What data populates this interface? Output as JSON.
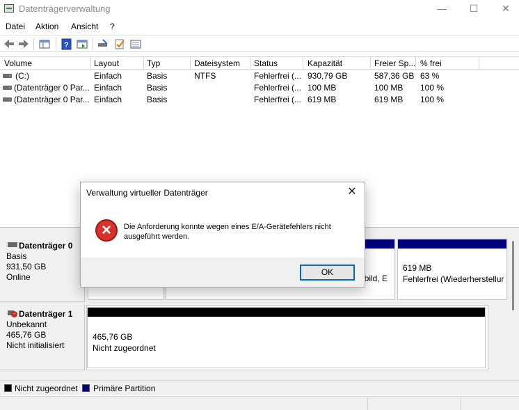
{
  "window": {
    "title": "Datenträgerverwaltung",
    "minimize_icon": "minimize-icon",
    "maximize_icon": "maximize-icon",
    "close_icon": "close-icon"
  },
  "menu": {
    "items": [
      "Datei",
      "Aktion",
      "Ansicht",
      "?"
    ]
  },
  "volume_list": {
    "columns": [
      "Volume",
      "Layout",
      "Typ",
      "Dateisystem",
      "Status",
      "Kapazität",
      "Freier Sp...",
      "% frei"
    ],
    "rows": [
      {
        "volume": "(C:)",
        "layout": "Einfach",
        "typ": "Basis",
        "dateisystem": "NTFS",
        "status": "Fehlerfrei (...",
        "kapazitaet": "930,79 GB",
        "frei": "587,36 GB",
        "prozent": "63 %"
      },
      {
        "volume": "(Datenträger 0 Par...",
        "layout": "Einfach",
        "typ": "Basis",
        "dateisystem": "",
        "status": "Fehlerfrei (...",
        "kapazitaet": "100 MB",
        "frei": "100 MB",
        "prozent": "100 %"
      },
      {
        "volume": "(Datenträger 0 Par...",
        "layout": "Einfach",
        "typ": "Basis",
        "dateisystem": "",
        "status": "Fehlerfrei (...",
        "kapazitaet": "619 MB",
        "frei": "619 MB",
        "prozent": "100 %"
      }
    ]
  },
  "disks": [
    {
      "name": "Datenträger 0",
      "type": "Basis",
      "size": "931,50 GB",
      "state": "Online",
      "partitions": [
        {
          "visible_text_1": "",
          "visible_text_2": ""
        },
        {
          "visible_text_1": "",
          "visible_text_2": "bbild, E"
        },
        {
          "visible_text_1": "619 MB",
          "visible_text_2": "Fehlerfrei (Wiederherstellur"
        }
      ]
    },
    {
      "name": "Datenträger 1",
      "type": "Unbekannt",
      "size": "465,76 GB",
      "state": "Nicht initialisiert",
      "partitions": [
        {
          "visible_text_1": "465,76 GB",
          "visible_text_2": "Nicht zugeordnet"
        }
      ]
    }
  ],
  "legend": [
    {
      "label": "Nicht zugeordnet",
      "color": "#000000"
    },
    {
      "label": "Primäre Partition",
      "color": "#00007f"
    }
  ],
  "colors": {
    "primary_partition": "#00007f",
    "unallocated": "#000000",
    "accent": "#0067c0",
    "error": "#d9312b"
  },
  "dialog": {
    "title": "Verwaltung virtueller Datenträger",
    "message": "Die Anforderung konnte wegen eines E/A-Gerätefehlers nicht ausgeführt werden.",
    "ok_label": "OK",
    "icon": "error-icon"
  }
}
